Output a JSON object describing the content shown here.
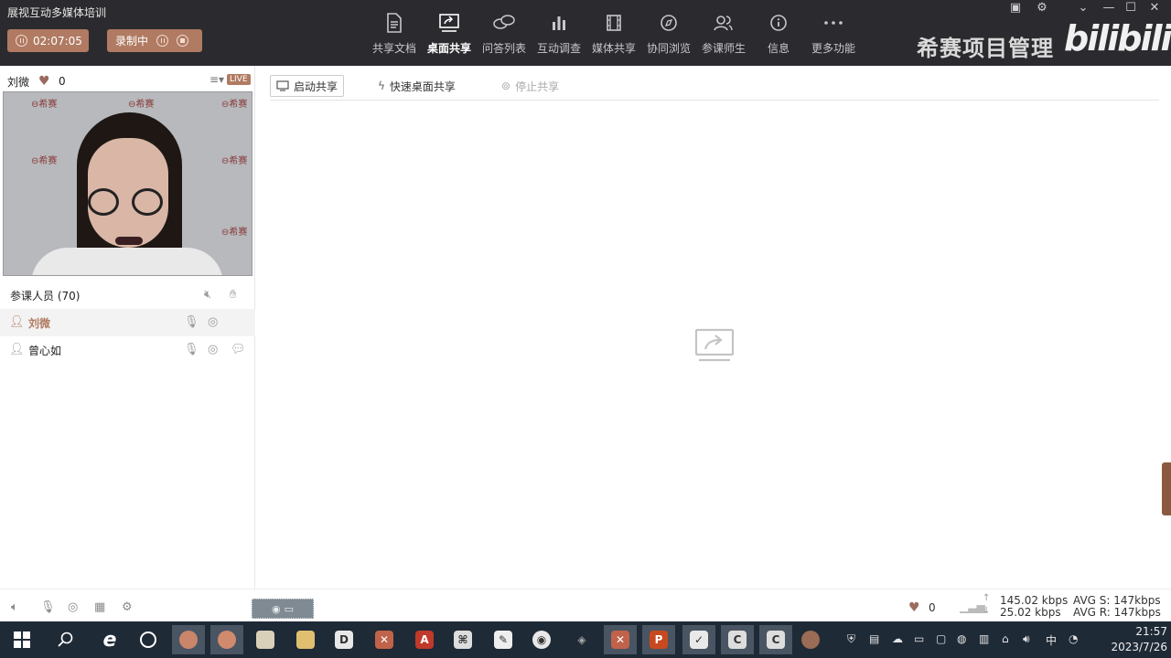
{
  "app": {
    "title": "展视互动多媒体培训",
    "timer": "02:07:05",
    "recording_label": "录制中"
  },
  "toolbar": {
    "items": [
      {
        "label": "共享文档",
        "icon": "document-icon"
      },
      {
        "label": "桌面共享",
        "icon": "desktop-share-icon",
        "active": true
      },
      {
        "label": "问答列表",
        "icon": "qa-bubble-icon"
      },
      {
        "label": "互动调查",
        "icon": "bar-chart-icon"
      },
      {
        "label": "媒体共享",
        "icon": "film-icon"
      },
      {
        "label": "协同浏览",
        "icon": "compass-icon"
      },
      {
        "label": "参课师生",
        "icon": "people-icon"
      },
      {
        "label": "信息",
        "icon": "info-icon"
      },
      {
        "label": "更多功能",
        "icon": "more-icon"
      }
    ]
  },
  "brand": {
    "text": "希赛项目管理",
    "logo": "bilibili"
  },
  "presenter": {
    "name": "刘微",
    "likes": "0",
    "live_badge": "LIVE"
  },
  "participants": {
    "header": "参课人员 (70)",
    "list": [
      {
        "name": "刘微",
        "selected": true
      },
      {
        "name": "曾心如",
        "selected": false
      }
    ]
  },
  "share": {
    "start_label": "启动共享",
    "quick_label": "快速桌面共享",
    "stop_label": "停止共享"
  },
  "status": {
    "likes": "0",
    "up_rate": "145.02 kbps",
    "down_rate": "25.02 kbps",
    "avg_send": "AVG S: 147kbps",
    "avg_recv": "AVG R: 147kbps"
  },
  "taskbar": {
    "time": "21:57",
    "date": "2023/7/26",
    "ime": "中"
  },
  "colors": {
    "topbar": "#2b2b2f",
    "accent": "#b07b62",
    "taskbar": "#1f2a37"
  }
}
